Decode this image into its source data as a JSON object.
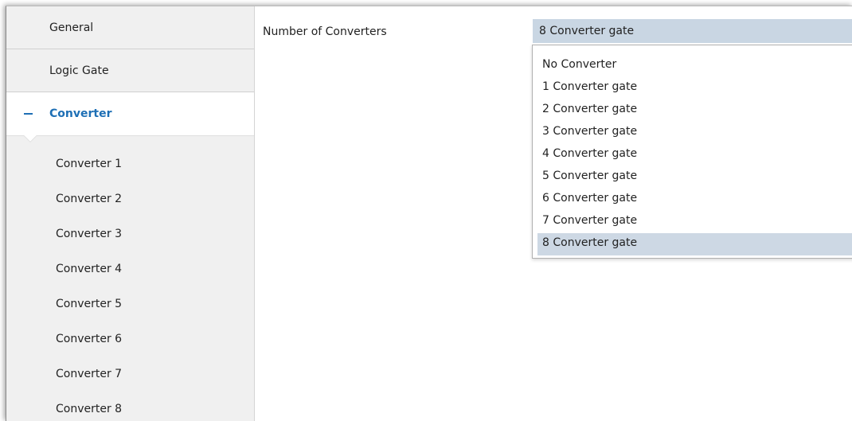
{
  "sidebar": {
    "items": [
      {
        "label": "General"
      },
      {
        "label": "Logic Gate"
      },
      {
        "label": "Converter"
      }
    ],
    "sub_items": [
      {
        "label": "Converter 1"
      },
      {
        "label": "Converter 2"
      },
      {
        "label": "Converter 3"
      },
      {
        "label": "Converter 4"
      },
      {
        "label": "Converter 5"
      },
      {
        "label": "Converter 6"
      },
      {
        "label": "Converter 7"
      },
      {
        "label": "Converter 8"
      }
    ]
  },
  "main": {
    "param_label": "Number of Converters",
    "selected_value": "8 Converter gate",
    "options": [
      {
        "label": "No Converter"
      },
      {
        "label": "1 Converter gate"
      },
      {
        "label": "2 Converter gate"
      },
      {
        "label": "3 Converter gate"
      },
      {
        "label": "4 Converter gate"
      },
      {
        "label": "5 Converter gate"
      },
      {
        "label": "6 Converter gate"
      },
      {
        "label": "7 Converter gate"
      },
      {
        "label": "8 Converter gate"
      }
    ]
  },
  "colors": {
    "accent": "#1e6fb5",
    "select_bg": "#c9d6e3",
    "check": "#5cb85c",
    "sidebar_bg": "#f0f0f0"
  },
  "icons": {
    "expand_state": "minus-icon",
    "dropdown": "caret-down-icon",
    "selected": "check-icon"
  }
}
